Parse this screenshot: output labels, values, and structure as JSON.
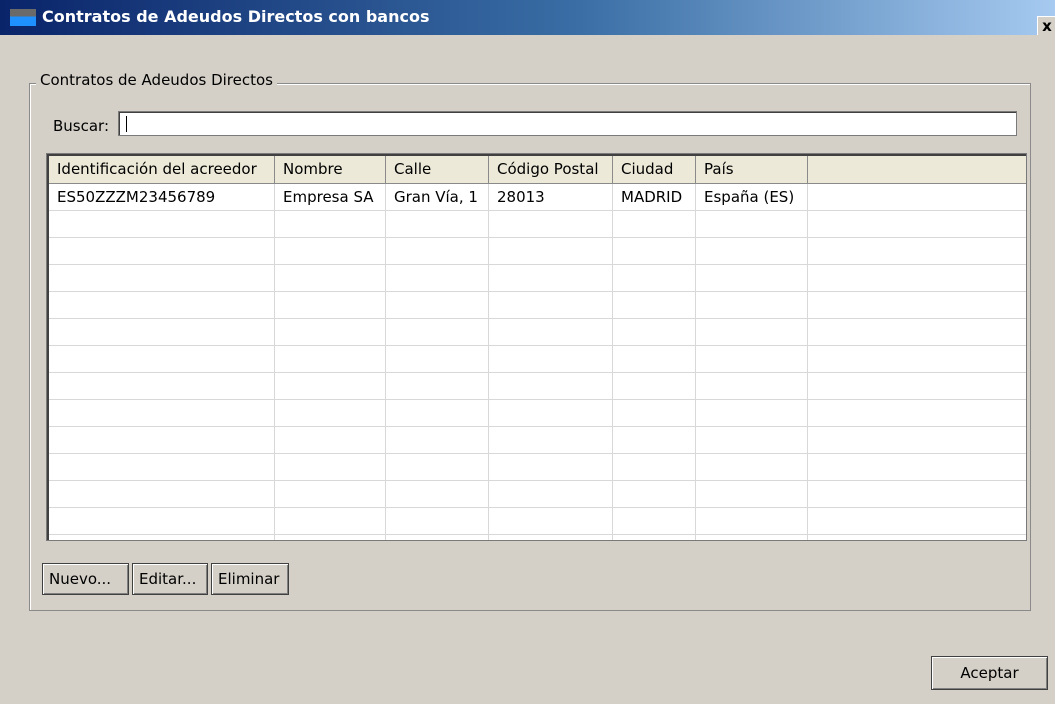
{
  "window": {
    "title": "Contratos de Adeudos Directos con bancos",
    "close": "x"
  },
  "group": {
    "label": "Contratos de Adeudos Directos"
  },
  "search": {
    "label": "Buscar:",
    "value": ""
  },
  "table": {
    "columns": [
      "Identificación del acreedor",
      "Nombre",
      "Calle",
      "Código Postal",
      "Ciudad",
      "País"
    ],
    "rows": [
      [
        "ES50ZZZM23456789",
        "Empresa SA",
        "Gran Vía, 1",
        "28013",
        "MADRID",
        "España (ES)"
      ]
    ]
  },
  "buttons": {
    "new": "Nuevo...",
    "edit": "Editar...",
    "delete": "Eliminar",
    "accept": "Aceptar"
  }
}
